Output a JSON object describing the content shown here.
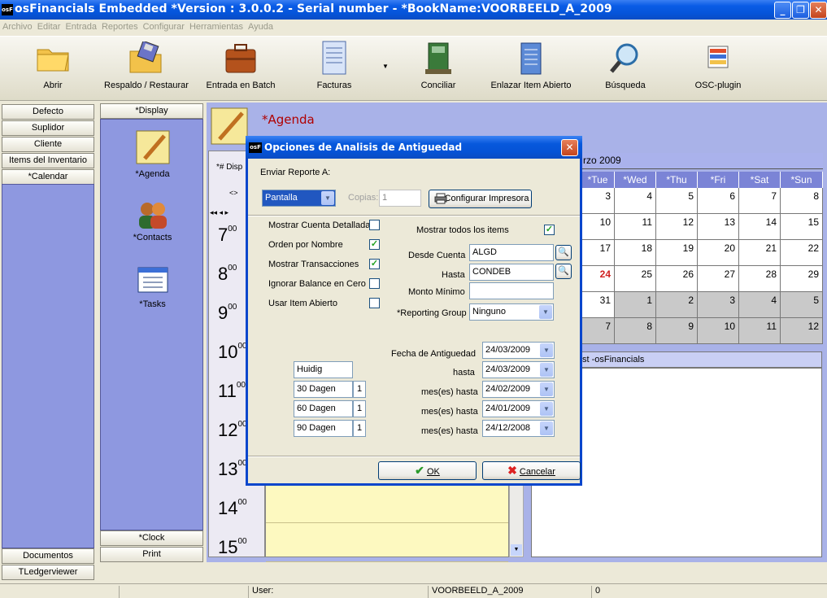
{
  "app": {
    "logo": "osF",
    "title": "osFinancials Embedded *Version : 3.0.0.2 - Serial number - *BookName:VOORBEELD_A_2009"
  },
  "window_buttons": {
    "minimize": "_",
    "restore": "❐",
    "close": "✕"
  },
  "menu": [
    "Archivo",
    "Editar",
    "Entrada",
    "Reportes",
    "Configurar",
    "Herramientas",
    "Ayuda"
  ],
  "toolbar": [
    {
      "label": "Abrir",
      "icon": "folder-icon"
    },
    {
      "label": "Respaldo / Restaurar",
      "icon": "backup-icon"
    },
    {
      "label": "Entrada en Batch",
      "icon": "briefcase-icon"
    },
    {
      "label": "Facturas",
      "icon": "invoice-icon"
    },
    {
      "label": "Conciliar",
      "icon": "reconcile-icon"
    },
    {
      "label": "Enlazar Item Abierto",
      "icon": "notepad-icon"
    },
    {
      "label": "Búsqueda",
      "icon": "magnifier-icon"
    },
    {
      "label": "OSC-plugin",
      "icon": "plugin-icon"
    }
  ],
  "nav": {
    "items": [
      "Defecto",
      "Suplidor",
      "Cliente",
      "Items del Inventario",
      "*Calendar"
    ],
    "bottom": [
      "Documentos",
      "TLedgerviewer"
    ]
  },
  "col2": {
    "header": "*Display",
    "items": [
      "*Agenda",
      "*Contacts",
      "*Tasks"
    ],
    "footer": [
      "*Clock",
      "Print"
    ]
  },
  "agenda": {
    "title": "*Agenda",
    "display_label": "*# Disp",
    "arrow_label": "˂˃"
  },
  "calendar": {
    "month": "rzo 2009",
    "days": [
      "*Tue",
      "*Wed",
      "*Thu",
      "*Fri",
      "*Sat",
      "*Sun"
    ],
    "weeks": [
      [
        "3",
        "4",
        "5",
        "6",
        "7",
        "8"
      ],
      [
        "10",
        "11",
        "12",
        "13",
        "14",
        "15"
      ],
      [
        "17",
        "18",
        "19",
        "20",
        "21",
        "22"
      ],
      [
        "24",
        "25",
        "26",
        "27",
        "28",
        "29"
      ],
      [
        "31",
        "1",
        "2",
        "3",
        "4",
        "5"
      ],
      [
        "7",
        "8",
        "9",
        "10",
        "11",
        "12"
      ]
    ],
    "today": "24",
    "tasklist": "st -osFinancials"
  },
  "hours": [
    {
      "h": "7",
      "m": "00"
    },
    {
      "h": "8",
      "m": "00"
    },
    {
      "h": "9",
      "m": "00"
    },
    {
      "h": "10",
      "m": "00"
    },
    {
      "h": "11",
      "m": "00"
    },
    {
      "h": "12",
      "m": "00"
    },
    {
      "h": "13",
      "m": "00"
    },
    {
      "h": "14",
      "m": "00"
    },
    {
      "h": "15",
      "m": "00"
    }
  ],
  "dialog": {
    "logo": "osF",
    "title": "Opciones de Analisis de Antiguedad",
    "enviar_label": "Enviar Reporte A:",
    "enviar_value": "Pantalla",
    "copias_label": "Copias:",
    "copias_value": "1",
    "config_button": "Configurar Impresora",
    "checks": [
      {
        "label": "Mostrar Cuenta Detallada",
        "checked": false
      },
      {
        "label": "Orden por Nombre",
        "checked": true
      },
      {
        "label": "Mostrar Transacciones",
        "checked": true
      },
      {
        "label": "Ignorar Balance en Cero",
        "checked": false
      },
      {
        "label": "Usar Item Abierto",
        "checked": false
      }
    ],
    "mostrar_todos_label": "Mostrar todos los items",
    "mostrar_todos_checked": true,
    "desde_label": "Desde Cuenta",
    "desde_value": "ALGD",
    "hasta_label": "Hasta",
    "hasta_value": "CONDEB",
    "monto_label": "Monto Mínimo",
    "monto_value": "",
    "reporting_label": "*Reporting Group",
    "reporting_value": "Ninguno",
    "fecha_label": "Fecha de Antiguedad",
    "fecha_value": "24/03/2009",
    "aging_rows": [
      {
        "name": "Huidig",
        "n": "",
        "label": "hasta",
        "date": "24/03/2009"
      },
      {
        "name": "30 Dagen",
        "n": "1",
        "label": "mes(es) hasta",
        "date": "24/02/2009"
      },
      {
        "name": "60 Dagen",
        "n": "1",
        "label": "mes(es) hasta",
        "date": "24/01/2009"
      },
      {
        "name": "90 Dagen",
        "n": "1",
        "label": "mes(es) hasta",
        "date": "24/12/2008"
      }
    ],
    "ok": "OK",
    "cancel": "Cancelar"
  },
  "status": {
    "user_label": "User:",
    "book": "VOORBEELD_A_2009",
    "count": "0"
  }
}
